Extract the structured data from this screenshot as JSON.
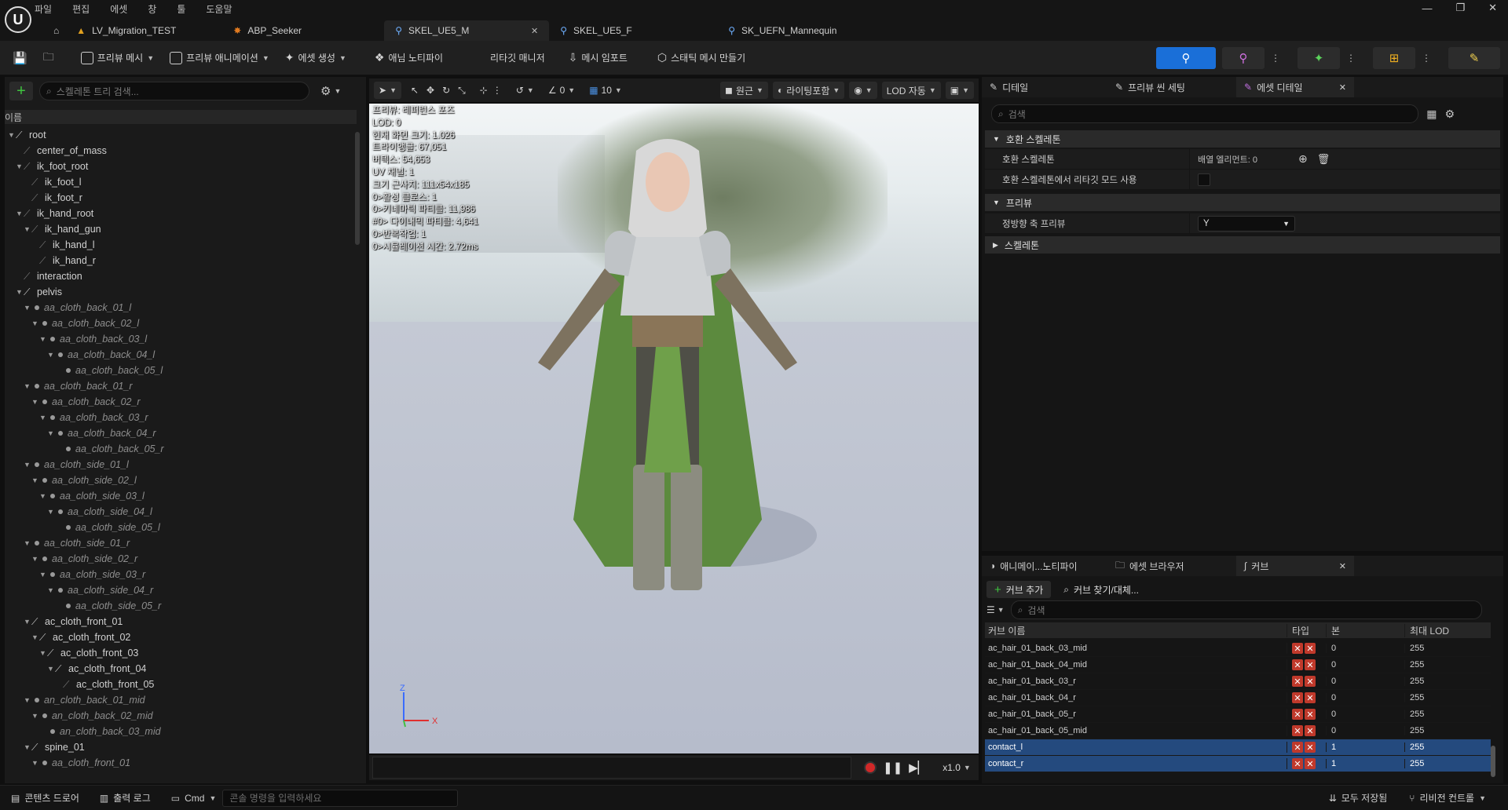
{
  "menu": [
    "파일",
    "편집",
    "에셋",
    "창",
    "툴",
    "도움말"
  ],
  "window_controls": [
    "—",
    "❐",
    "✕"
  ],
  "tabs": [
    {
      "label": "LV_Migration_TEST",
      "icon": "level-icon"
    },
    {
      "label": "ABP_Seeker",
      "icon": "anim-blueprint-icon"
    },
    {
      "label": "SKEL_UE5_M",
      "icon": "skeleton-icon",
      "active": true
    },
    {
      "label": "SKEL_UE5_F",
      "icon": "skeleton-icon"
    },
    {
      "label": "SK_UEFN_Mannequin",
      "icon": "skeleton-icon"
    }
  ],
  "toolbar": {
    "preview_mesh": "프리뷰 메시",
    "preview_animation": "프리뷰 애니메이션",
    "create_asset": "에셋 생성",
    "anim_notify": "애님 노티파이",
    "retarget_manager": "리타깃 매니저",
    "import_mesh": "메시 임포트",
    "make_static_mesh": "스태틱 메시 만들기"
  },
  "skeleton_tree": {
    "search_placeholder": "스켈레톤 트리 검색...",
    "column_name": "이름",
    "nodes": [
      {
        "label": "root",
        "depth": 0,
        "style": "bone",
        "arrow": true
      },
      {
        "label": "center_of_mass",
        "depth": 1,
        "style": "bone-faint",
        "arrow": false
      },
      {
        "label": "ik_foot_root",
        "depth": 1,
        "style": "bone-faint",
        "arrow": true
      },
      {
        "label": "ik_foot_l",
        "depth": 2,
        "style": "bone-faint",
        "arrow": false
      },
      {
        "label": "ik_foot_r",
        "depth": 2,
        "style": "bone-faint",
        "arrow": false
      },
      {
        "label": "ik_hand_root",
        "depth": 1,
        "style": "bone-faint",
        "arrow": true
      },
      {
        "label": "ik_hand_gun",
        "depth": 2,
        "style": "bone-faint",
        "arrow": true
      },
      {
        "label": "ik_hand_l",
        "depth": 3,
        "style": "bone-faint",
        "arrow": false
      },
      {
        "label": "ik_hand_r",
        "depth": 3,
        "style": "bone-faint",
        "arrow": false
      },
      {
        "label": "interaction",
        "depth": 1,
        "style": "bone-faint",
        "arrow": false
      },
      {
        "label": "pelvis",
        "depth": 1,
        "style": "bone",
        "arrow": true
      },
      {
        "label": "aa_cloth_back_01_l",
        "depth": 2,
        "style": "dot",
        "arrow": true
      },
      {
        "label": "aa_cloth_back_02_l",
        "depth": 3,
        "style": "dot",
        "arrow": true
      },
      {
        "label": "aa_cloth_back_03_l",
        "depth": 4,
        "style": "dot",
        "arrow": true
      },
      {
        "label": "aa_cloth_back_04_l",
        "depth": 5,
        "style": "dot",
        "arrow": true
      },
      {
        "label": "aa_cloth_back_05_l",
        "depth": 6,
        "style": "dot",
        "arrow": false
      },
      {
        "label": "aa_cloth_back_01_r",
        "depth": 2,
        "style": "dot",
        "arrow": true
      },
      {
        "label": "aa_cloth_back_02_r",
        "depth": 3,
        "style": "dot",
        "arrow": true
      },
      {
        "label": "aa_cloth_back_03_r",
        "depth": 4,
        "style": "dot",
        "arrow": true
      },
      {
        "label": "aa_cloth_back_04_r",
        "depth": 5,
        "style": "dot",
        "arrow": true
      },
      {
        "label": "aa_cloth_back_05_r",
        "depth": 6,
        "style": "dot",
        "arrow": false
      },
      {
        "label": "aa_cloth_side_01_l",
        "depth": 2,
        "style": "dot",
        "arrow": true
      },
      {
        "label": "aa_cloth_side_02_l",
        "depth": 3,
        "style": "dot",
        "arrow": true
      },
      {
        "label": "aa_cloth_side_03_l",
        "depth": 4,
        "style": "dot",
        "arrow": true
      },
      {
        "label": "aa_cloth_side_04_l",
        "depth": 5,
        "style": "dot",
        "arrow": true
      },
      {
        "label": "aa_cloth_side_05_l",
        "depth": 6,
        "style": "dot",
        "arrow": false
      },
      {
        "label": "aa_cloth_side_01_r",
        "depth": 2,
        "style": "dot",
        "arrow": true
      },
      {
        "label": "aa_cloth_side_02_r",
        "depth": 3,
        "style": "dot",
        "arrow": true
      },
      {
        "label": "aa_cloth_side_03_r",
        "depth": 4,
        "style": "dot",
        "arrow": true
      },
      {
        "label": "aa_cloth_side_04_r",
        "depth": 5,
        "style": "dot",
        "arrow": true
      },
      {
        "label": "aa_cloth_side_05_r",
        "depth": 6,
        "style": "dot",
        "arrow": false
      },
      {
        "label": "ac_cloth_front_01",
        "depth": 2,
        "style": "bone",
        "arrow": true
      },
      {
        "label": "ac_cloth_front_02",
        "depth": 3,
        "style": "bone",
        "arrow": true
      },
      {
        "label": "ac_cloth_front_03",
        "depth": 4,
        "style": "bone",
        "arrow": true
      },
      {
        "label": "ac_cloth_front_04",
        "depth": 5,
        "style": "bone",
        "arrow": true
      },
      {
        "label": "ac_cloth_front_05",
        "depth": 6,
        "style": "bone-faint",
        "arrow": false
      },
      {
        "label": "an_cloth_back_01_mid",
        "depth": 2,
        "style": "dot",
        "arrow": true
      },
      {
        "label": "an_cloth_back_02_mid",
        "depth": 3,
        "style": "dot",
        "arrow": true
      },
      {
        "label": "an_cloth_back_03_mid",
        "depth": 4,
        "style": "dot",
        "arrow": false
      },
      {
        "label": "spine_01",
        "depth": 2,
        "style": "bone",
        "arrow": true
      },
      {
        "label": "aa_cloth_front_01",
        "depth": 3,
        "style": "dot",
        "arrow": true
      }
    ]
  },
  "viewport": {
    "view_mode": "원근",
    "lighting": "라이팅포함",
    "lod": "LOD 자동",
    "rotation_snap": "0",
    "grid": "10",
    "stats": [
      "프리뷰: 레퍼런스 포즈",
      "LOD: 0",
      "현재 화면 크기: 1.026",
      "트라이앵글: 67,051",
      "버텍스: 54,653",
      "UV 채널: 1",
      "크기 근사치: 111x54x185",
      "0>활성 클로스: 1",
      "0>키네마틱 파티클: 11,986",
      "#0> 다이내믹 파티클: 4,641",
      "0>반복작업: 1",
      "0>시뮬레이션 시간: 2.72ms"
    ],
    "gizmo": {
      "z": "Z",
      "x": "X"
    },
    "speed": "x1.0"
  },
  "details": {
    "tabs": [
      "디테일",
      "프리뷰 씬 세팅",
      "에셋 디테일"
    ],
    "search_placeholder": "검색",
    "sections": {
      "compat": "호환 스켈레톤",
      "compat_prop": "호환 스켈레톤",
      "compat_value": "배열 엘리먼트: 0",
      "retarget_prop": "호환 스켈레톤에서 리타깃 모드 사용",
      "preview": "프리뷰",
      "forward_axis": "정방향 축 프리뷰",
      "forward_axis_value": "Y",
      "skeleton": "스켈레톤"
    }
  },
  "curves": {
    "tabs": [
      "애니메이...노티파이",
      "에셋 브라우저",
      "커브"
    ],
    "add_curve": "커브 추가",
    "find_replace": "커브 찾기/대체...",
    "search_placeholder": "검색",
    "columns": [
      "커브 이름",
      "타입",
      "본",
      "최대 LOD"
    ],
    "rows": [
      {
        "name": "ac_hair_01_back_03_mid",
        "bone": "0",
        "lod": "255",
        "selected": false
      },
      {
        "name": "ac_hair_01_back_04_mid",
        "bone": "0",
        "lod": "255",
        "selected": false
      },
      {
        "name": "ac_hair_01_back_03_r",
        "bone": "0",
        "lod": "255",
        "selected": false
      },
      {
        "name": "ac_hair_01_back_04_r",
        "bone": "0",
        "lod": "255",
        "selected": false
      },
      {
        "name": "ac_hair_01_back_05_r",
        "bone": "0",
        "lod": "255",
        "selected": false
      },
      {
        "name": "ac_hair_01_back_05_mid",
        "bone": "0",
        "lod": "255",
        "selected": false
      },
      {
        "name": "contact_l",
        "bone": "1",
        "lod": "255",
        "selected": true
      },
      {
        "name": "contact_r",
        "bone": "1",
        "lod": "255",
        "selected": true
      }
    ]
  },
  "status": {
    "content_drawer": "콘텐츠 드로어",
    "output_log": "출력 로그",
    "cmd": "Cmd",
    "cmd_placeholder": "콘솔 명령을 입력하세요",
    "save_all": "모두 저장됨",
    "revision_control": "리비전 컨트롤"
  },
  "colors": {
    "accent_blue": "#1a6fd8",
    "selection": "#244a7e",
    "add_green": "#3fc43f"
  }
}
